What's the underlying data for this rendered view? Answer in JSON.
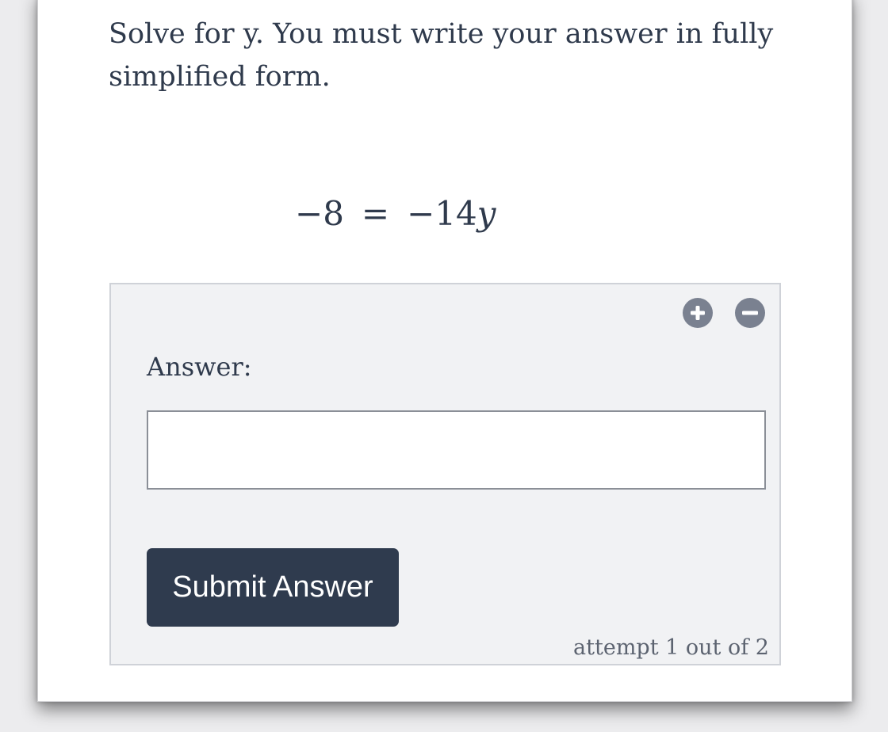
{
  "question": {
    "text": "Solve for y. You must write your answer in fully simplified form."
  },
  "equation": {
    "lhs": "−8",
    "equals": "=",
    "rhs_coefficient": "−14",
    "rhs_variable": "y"
  },
  "answer_panel": {
    "plus_icon": "plus-circle-icon",
    "minus_icon": "minus-circle-icon",
    "label": "Answer:",
    "input_value": "",
    "submit_label": "Submit Answer",
    "attempt_text": "attempt 1 out of 2"
  },
  "colors": {
    "text": "#2f3a4c",
    "button_bg": "#2f3b4e",
    "panel_bg": "#f1f2f4",
    "icon_bg": "#7a8190"
  }
}
